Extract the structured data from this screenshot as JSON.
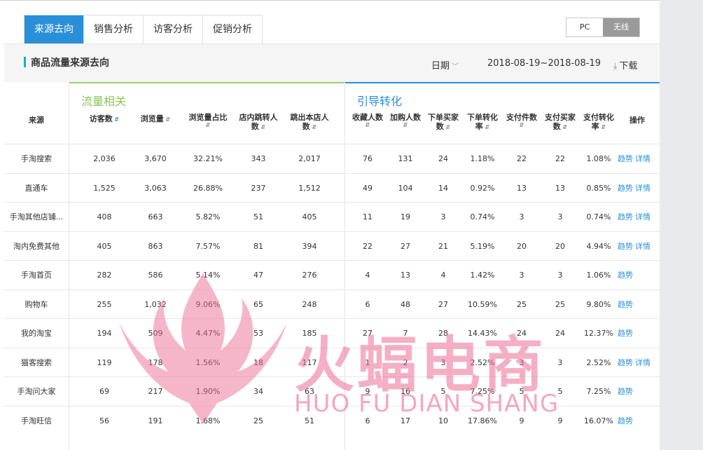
{
  "tabs": [
    {
      "label": "来源去向",
      "active": true
    },
    {
      "label": "销售分析",
      "active": false
    },
    {
      "label": "访客分析",
      "active": false
    },
    {
      "label": "促销分析",
      "active": false
    }
  ],
  "device_toggle": {
    "pc": "PC",
    "wireless": "无线",
    "selected": "无线"
  },
  "panel": {
    "title": "商品流量来源去向",
    "date_label": "日期",
    "date_range": "2018-08-19~2018-08-19",
    "download": "下载"
  },
  "groups": {
    "traffic": "流量相关",
    "conversion": "引导转化"
  },
  "columns": {
    "source": "来源",
    "visitors": "访客数",
    "pageviews": "浏览量",
    "pv_share": "浏览量占比",
    "in_store_jump_1": "店内跳转人",
    "in_store_jump_2": "数",
    "exit_1": "跳出本店人",
    "exit_2": "数",
    "favorites_1": "收藏人数",
    "cart": "加购人数",
    "order_buyers_1": "下单买家",
    "order_buyers_2": "数",
    "order_rate_1": "下单转化",
    "order_rate_2": "率",
    "paid_items": "支付件数",
    "paid_buyers_1": "支付买家",
    "paid_buyers_2": "数",
    "paid_rate_1": "支付转化",
    "paid_rate_2": "率",
    "operation": "操作"
  },
  "row_links": {
    "trend": "趋势",
    "detail": "详情"
  },
  "rows": [
    {
      "source": "手淘搜索",
      "visitors": "2,036",
      "pageviews": "3,670",
      "pv_share": "32.21%",
      "jump": "343",
      "exit": "2,017",
      "fav": "76",
      "cart": "131",
      "order_buyers": "24",
      "order_rate": "1.18%",
      "paid_items": "22",
      "paid_buyers": "22",
      "paid_rate": "1.08%",
      "detail": true
    },
    {
      "source": "直通车",
      "visitors": "1,525",
      "pageviews": "3,063",
      "pv_share": "26.88%",
      "jump": "237",
      "exit": "1,512",
      "fav": "49",
      "cart": "104",
      "order_buyers": "14",
      "order_rate": "0.92%",
      "paid_items": "13",
      "paid_buyers": "13",
      "paid_rate": "0.85%",
      "detail": true
    },
    {
      "source": "手淘其他店铺...",
      "visitors": "408",
      "pageviews": "663",
      "pv_share": "5.82%",
      "jump": "51",
      "exit": "405",
      "fav": "11",
      "cart": "19",
      "order_buyers": "3",
      "order_rate": "0.74%",
      "paid_items": "3",
      "paid_buyers": "3",
      "paid_rate": "0.74%",
      "detail": true
    },
    {
      "source": "淘内免费其他",
      "visitors": "405",
      "pageviews": "863",
      "pv_share": "7.57%",
      "jump": "81",
      "exit": "394",
      "fav": "22",
      "cart": "27",
      "order_buyers": "21",
      "order_rate": "5.19%",
      "paid_items": "20",
      "paid_buyers": "20",
      "paid_rate": "4.94%",
      "detail": true
    },
    {
      "source": "手淘首页",
      "visitors": "282",
      "pageviews": "586",
      "pv_share": "5.14%",
      "jump": "47",
      "exit": "276",
      "fav": "4",
      "cart": "13",
      "order_buyers": "4",
      "order_rate": "1.42%",
      "paid_items": "3",
      "paid_buyers": "3",
      "paid_rate": "1.06%",
      "detail": false
    },
    {
      "source": "购物车",
      "visitors": "255",
      "pageviews": "1,032",
      "pv_share": "9.06%",
      "jump": "65",
      "exit": "248",
      "fav": "6",
      "cart": "48",
      "order_buyers": "27",
      "order_rate": "10.59%",
      "paid_items": "25",
      "paid_buyers": "25",
      "paid_rate": "9.80%",
      "detail": false
    },
    {
      "source": "我的淘宝",
      "visitors": "194",
      "pageviews": "509",
      "pv_share": "4.47%",
      "jump": "53",
      "exit": "185",
      "fav": "27",
      "cart": "7",
      "order_buyers": "28",
      "order_rate": "14.43%",
      "paid_items": "24",
      "paid_buyers": "24",
      "paid_rate": "12.37%",
      "detail": false
    },
    {
      "source": "猫客搜索",
      "visitors": "119",
      "pageviews": "178",
      "pv_share": "1.56%",
      "jump": "18",
      "exit": "117",
      "fav": "1",
      "cart": "2",
      "order_buyers": "3",
      "order_rate": "2.52%",
      "paid_items": "3",
      "paid_buyers": "3",
      "paid_rate": "2.52%",
      "detail": true
    },
    {
      "source": "手淘问大家",
      "visitors": "69",
      "pageviews": "217",
      "pv_share": "1.90%",
      "jump": "34",
      "exit": "63",
      "fav": "9",
      "cart": "16",
      "order_buyers": "5",
      "order_rate": "7.25%",
      "paid_items": "5",
      "paid_buyers": "5",
      "paid_rate": "7.25%",
      "detail": false
    },
    {
      "source": "手淘旺信",
      "visitors": "56",
      "pageviews": "191",
      "pv_share": "1.68%",
      "jump": "25",
      "exit": "51",
      "fav": "6",
      "cart": "17",
      "order_buyers": "10",
      "order_rate": "17.86%",
      "paid_items": "9",
      "paid_buyers": "9",
      "paid_rate": "16.07%",
      "detail": false
    }
  ],
  "watermark": {
    "text": "火蝠电商",
    "subtext": "HUO FU DIAN SHANG"
  }
}
